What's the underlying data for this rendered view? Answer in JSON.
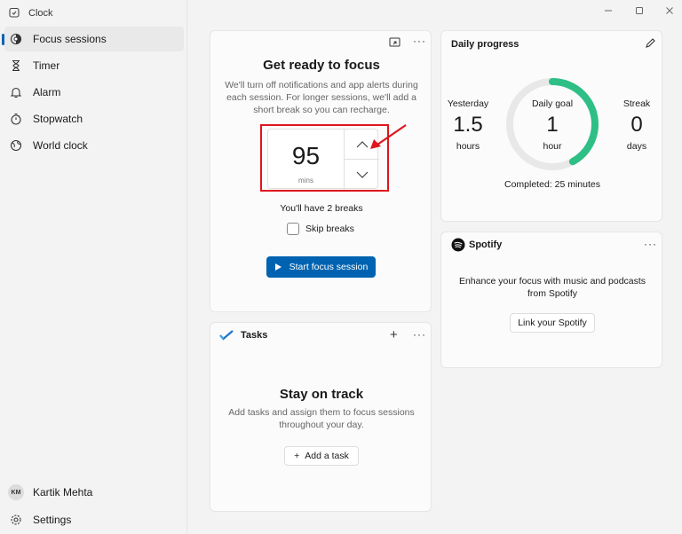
{
  "app": {
    "title": "Clock"
  },
  "sidebar": {
    "items": [
      {
        "label": "Focus sessions",
        "icon": "focus-icon",
        "active": true
      },
      {
        "label": "Timer",
        "icon": "hourglass-icon"
      },
      {
        "label": "Alarm",
        "icon": "bell-icon"
      },
      {
        "label": "Stopwatch",
        "icon": "stopwatch-icon"
      },
      {
        "label": "World clock",
        "icon": "globe-icon"
      }
    ],
    "user": {
      "initials": "KM",
      "name": "Kartik Mehta"
    },
    "settings_label": "Settings"
  },
  "focus": {
    "title": "Get ready to focus",
    "description": "We'll turn off notifications and app alerts during each session. For longer sessions, we'll add a short break so you can recharge.",
    "minutes": "95",
    "unit": "mins",
    "breaks_info": "You'll have 2 breaks",
    "skip_label": "Skip breaks",
    "skip_checked": false,
    "start_label": "Start focus session",
    "highlight_color": "#e0141e"
  },
  "tasks": {
    "header": "Tasks",
    "title": "Stay on track",
    "description": "Add tasks and assign them to focus sessions throughout your day.",
    "add_label": "Add a task"
  },
  "progress": {
    "title": "Daily progress",
    "yesterday": {
      "label": "Yesterday",
      "value": "1.5",
      "unit": "hours"
    },
    "goal": {
      "label": "Daily goal",
      "value": "1",
      "unit": "hour",
      "fraction": 0.42
    },
    "streak": {
      "label": "Streak",
      "value": "0",
      "unit": "days"
    },
    "completed": "Completed: 25 minutes",
    "accent_color": "#2ebf86"
  },
  "spotify": {
    "name": "Spotify",
    "description": "Enhance your focus with music and podcasts from Spotify",
    "link_label": "Link your Spotify"
  },
  "accent": "#0063b1"
}
